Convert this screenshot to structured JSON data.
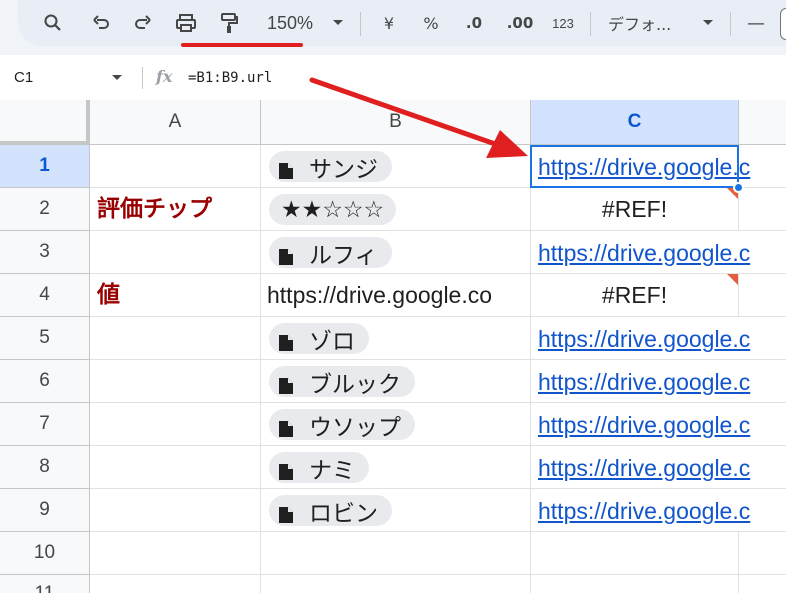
{
  "toolbar": {
    "zoom": "150%",
    "currency": "¥",
    "percent": "%",
    "dec_less": ".0",
    "dec_more": ".00",
    "number_format": "123",
    "font": "デフォ...",
    "font_size_minus": "—"
  },
  "formula_bar": {
    "name_box": "C1",
    "fx": "fx",
    "formula": "=B1:B9.url"
  },
  "columns": [
    "A",
    "B",
    "C"
  ],
  "rows": [
    "1",
    "2",
    "3",
    "4",
    "5",
    "6",
    "7",
    "8",
    "9",
    "10",
    "11"
  ],
  "cells": {
    "A2": "評価チップ",
    "A4": "値",
    "B1": "サンジ",
    "B2": "★★☆☆☆",
    "B3": "ルフィ",
    "B4": "https://drive.google.co",
    "B5": "ゾロ",
    "B6": "ブルック",
    "B7": "ウソップ",
    "B8": "ナミ",
    "B9": "ロビン",
    "C1": "https://drive.google.c",
    "C2": "#REF!",
    "C3": "https://drive.google.c",
    "C4": "#REF!",
    "C5": "https://drive.google.c",
    "C6": "https://drive.google.c",
    "C7": "https://drive.google.c",
    "C8": "https://drive.google.c",
    "C9": "https://drive.google.c"
  },
  "colors": {
    "accent": "#1a73e8",
    "annotation_red": "#e02020",
    "label_red": "#990000",
    "link_blue": "#1155cc"
  }
}
